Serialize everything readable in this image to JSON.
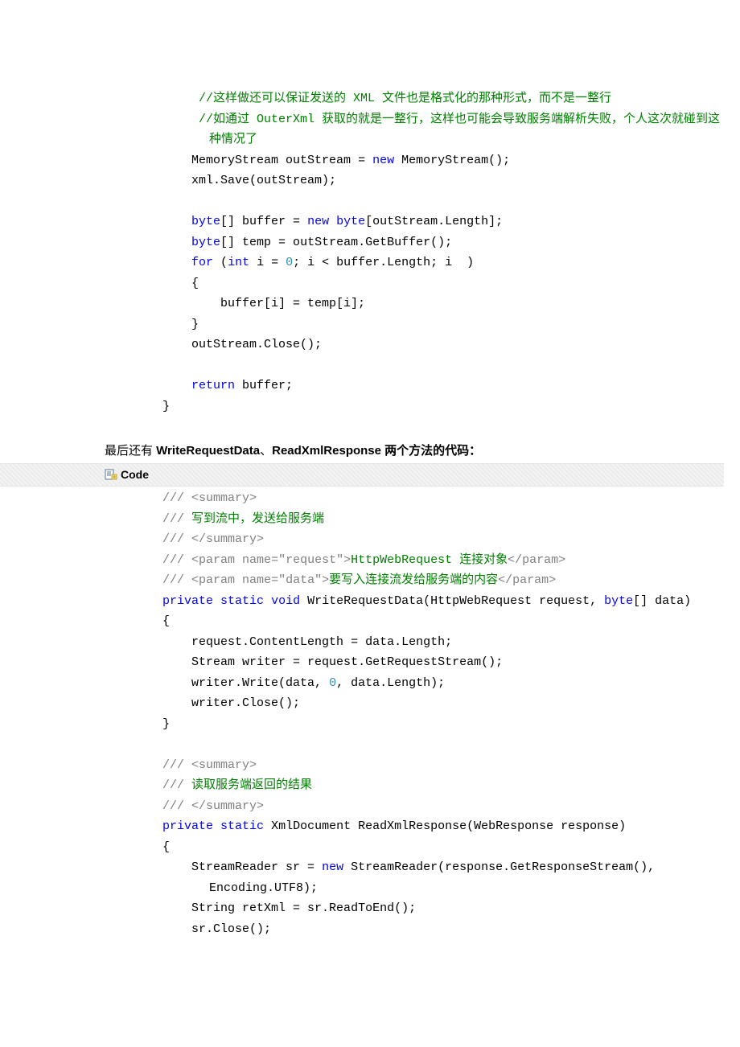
{
  "block1": {
    "l01a": "             //这样做还可以保证发送的 XML 文件也是格式化的那种形式，而不是一整行",
    "l02a": "             //如通过 OuterXml 获取的就是一整行，这样也可能会导致服务端解析失败，个人这次就碰到这种情况了",
    "l03": "            MemoryStream outStream = ",
    "l03n": "new",
    "l03b": " MemoryStream();",
    "l04": "            xml.Save(outStream);",
    "blank1": "",
    "l05a": "            ",
    "l05b": "byte",
    "l05c": "[] buffer = ",
    "l05d": "new",
    "l05e": " ",
    "l05f": "byte",
    "l05g": "[outStream.Length];",
    "l06a": "            ",
    "l06b": "byte",
    "l06c": "[] temp = outStream.GetBuffer();",
    "l07a": "            ",
    "l07b": "for",
    "l07c": " (",
    "l07d": "int",
    "l07e": " i = ",
    "l07f": "0",
    "l07g": "; i < buffer.Length; i  )",
    "l08": "            {",
    "l09": "                buffer[i] = temp[i];",
    "l10": "            }",
    "l11": "            outStream.Close();",
    "blank2": "",
    "l12a": "            ",
    "l12b": "return",
    "l12c": " buffer;",
    "l13": "        }"
  },
  "heading": {
    "pre": "最后还有 ",
    "b1": "WriteRequestData",
    "sep": "、",
    "b2": "ReadXmlResponse",
    "post": " 两个方法的代码：",
    "codeLabel": "Code"
  },
  "block2": {
    "s1a": "        ",
    "s1b": "///",
    "s1c": " ",
    "s1d": "<summary>",
    "s2a": "        ",
    "s2b": "///",
    "s2c": " 写到流中，发送给服务端",
    "s3a": "        ",
    "s3b": "///",
    "s3c": " ",
    "s3d": "</summary>",
    "s4a": "        ",
    "s4b": "///",
    "s4c": " ",
    "s4d": "<param name=\"",
    "s4e": "request",
    "s4f": "\">",
    "s4g": "HttpWebRequest 连接对象",
    "s4h": "</param>",
    "s5a": "        ",
    "s5b": "///",
    "s5c": " ",
    "s5d": "<param name=\"",
    "s5e": "data",
    "s5f": "\">",
    "s5g": "要写入连接流发给服务端的内容",
    "s5h": "</param>",
    "m1a": "        ",
    "m1b": "private",
    "m1c": " ",
    "m1d": "static",
    "m1e": " ",
    "m1f": "void",
    "m1g": " WriteRequestData(HttpWebRequest request, ",
    "m1h": "byte",
    "m1i": "[] data)",
    "m2": "        {",
    "m3": "            request.ContentLength = data.Length;",
    "m4": "            Stream writer = request.GetRequestStream();",
    "m5a": "            writer.Write(data, ",
    "m5b": "0",
    "m5c": ", data.Length);",
    "m6": "            writer.Close();",
    "m7": "        }",
    "blank3": "",
    "s6a": "        ",
    "s6b": "///",
    "s6c": " ",
    "s6d": "<summary>",
    "s7a": "        ",
    "s7b": "///",
    "s7c": " 读取服务端返回的结果",
    "s8a": "        ",
    "s8b": "///",
    "s8c": " ",
    "s8d": "</summary>",
    "r1a": "        ",
    "r1b": "private",
    "r1c": " ",
    "r1d": "static",
    "r1e": " XmlDocument ReadXmlResponse(WebResponse response)",
    "r2": "        {",
    "r3a": "            StreamReader sr = ",
    "r3b": "new",
    "r3c": " StreamReader(response.GetResponseStream(), Encoding.UTF8);",
    "r4": "            String retXml = sr.ReadToEnd();",
    "r5": "            sr.Close();"
  }
}
